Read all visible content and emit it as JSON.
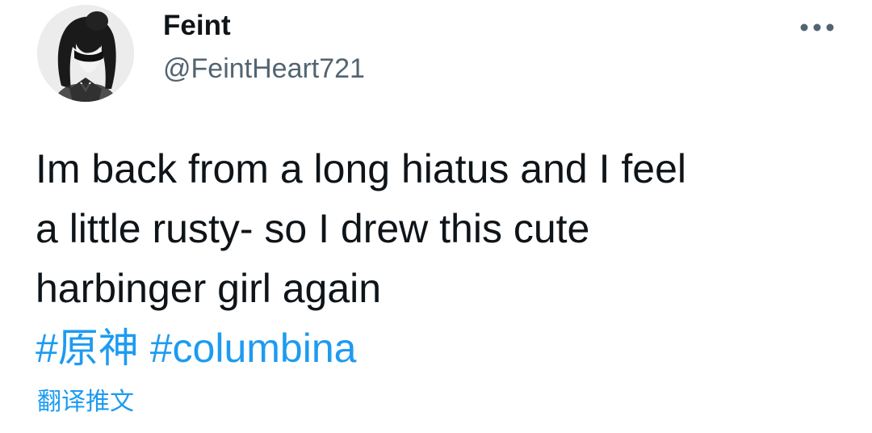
{
  "tweet": {
    "display_name": "Feint",
    "handle": "@FeintHeart721",
    "text_lines": [
      "Im back from a long hiatus and I feel",
      "a little rusty- so I drew this cute",
      "harbinger girl again"
    ],
    "hashtags": [
      "#原神",
      "#columbina"
    ],
    "translate_label": "翻译推文",
    "more_icon": "more-horizontal-icon",
    "avatar_icon": "avatar-image"
  },
  "colors": {
    "link": "#1d9bf0",
    "text": "#0f1419",
    "secondary": "#536471"
  }
}
